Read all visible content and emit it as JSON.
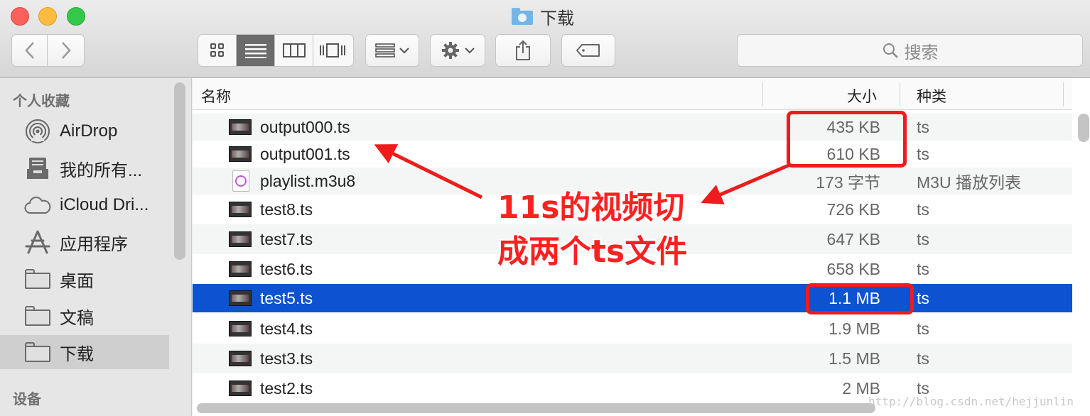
{
  "window": {
    "title": "下载"
  },
  "toolbar": {
    "back_icon": "chevron-left-icon",
    "forward_icon": "chevron-right-icon",
    "view_modes": [
      "icon-view",
      "list-view",
      "column-view",
      "cover-flow-view"
    ],
    "active_view": "list-view",
    "search_placeholder": "搜索"
  },
  "sidebar": {
    "favorites_heading": "个人收藏",
    "items": [
      {
        "label": "AirDrop",
        "icon": "airdrop-icon"
      },
      {
        "label": "我的所有...",
        "icon": "all-files-icon"
      },
      {
        "label": "iCloud Dri...",
        "icon": "cloud-icon"
      },
      {
        "label": "应用程序",
        "icon": "applications-icon"
      },
      {
        "label": "桌面",
        "icon": "folder-icon"
      },
      {
        "label": "文稿",
        "icon": "folder-icon"
      },
      {
        "label": "下载",
        "icon": "folder-icon",
        "selected": true
      }
    ],
    "devices_heading": "设备"
  },
  "columns": {
    "name": "名称",
    "size": "大小",
    "kind": "种类"
  },
  "files": [
    {
      "name": "output000.ts",
      "size": "435 KB",
      "kind": "ts"
    },
    {
      "name": "output001.ts",
      "size": "610 KB",
      "kind": "ts"
    },
    {
      "name": "playlist.m3u8",
      "size": "173 字节",
      "kind": "M3U 播放列表"
    },
    {
      "name": "test8.ts",
      "size": "726 KB",
      "kind": "ts"
    },
    {
      "name": "test7.ts",
      "size": "647 KB",
      "kind": "ts"
    },
    {
      "name": "test6.ts",
      "size": "658 KB",
      "kind": "ts"
    },
    {
      "name": "test5.ts",
      "size": "1.1 MB",
      "kind": "ts",
      "selected": true
    },
    {
      "name": "test4.ts",
      "size": "1.9 MB",
      "kind": "ts"
    },
    {
      "name": "test3.ts",
      "size": "1.5 MB",
      "kind": "ts"
    },
    {
      "name": "test2.ts",
      "size": "2 MB",
      "kind": "ts"
    }
  ],
  "annotation": {
    "line1": "11s的视频切",
    "line2": "成两个ts文件"
  },
  "watermark": "http://blog.csdn.net/hejjunlin"
}
